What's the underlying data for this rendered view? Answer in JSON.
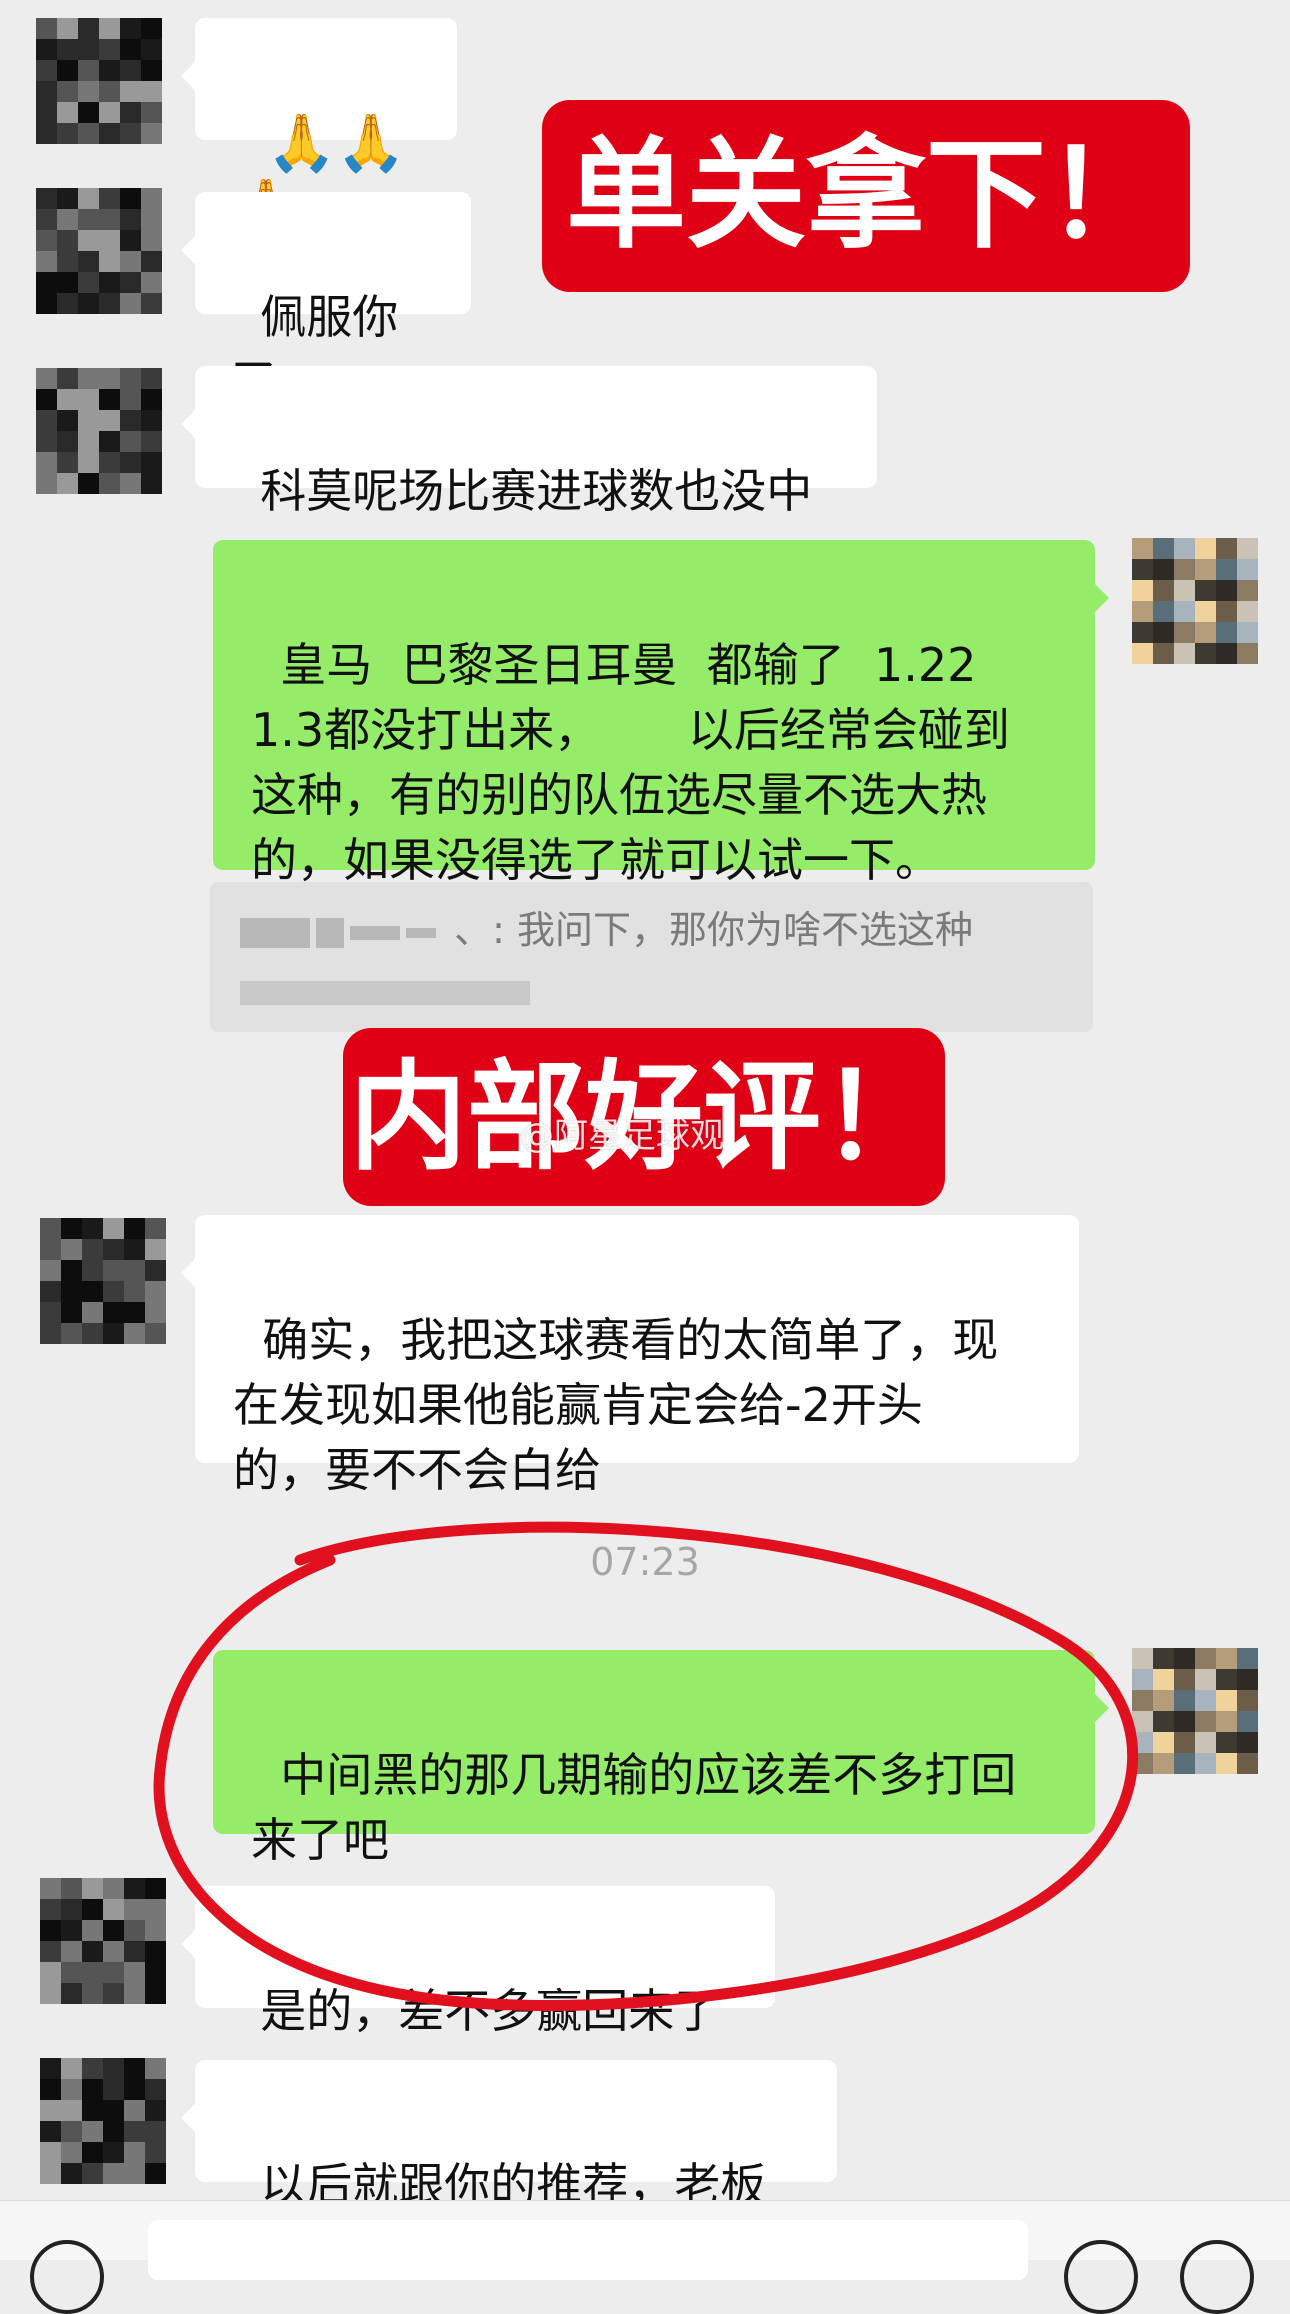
{
  "messages": [
    {
      "id": "m1",
      "side": "in",
      "text": "🙏🙏🙏"
    },
    {
      "id": "m2",
      "side": "in",
      "text": "佩服你了"
    },
    {
      "id": "m3",
      "side": "in",
      "text": "科莫呢场比赛进球数也没中"
    },
    {
      "id": "m4",
      "side": "out",
      "text": "皇马  巴黎圣日耳曼  都输了  1.22\n1.3都没打出来，      以后经常会碰到\n这种，有的别的队伍选尽量不选大热\n的，如果没得选了就可以试一下。"
    },
    {
      "id": "m5",
      "side": "in",
      "text": "确实，我把这球赛看的太简单了，现\n在发现如果他能赢肯定会给-2开头\n的，要不不会白给"
    },
    {
      "id": "m6",
      "side": "out",
      "text": "中间黑的那几期输的应该差不多打回\n来了吧"
    },
    {
      "id": "m7",
      "side": "in",
      "text": "是的，差不多赢回来了"
    },
    {
      "id": "m8",
      "side": "in",
      "text": "以后就跟你的推荐，老板"
    }
  ],
  "quote": {
    "suffix": "、: 我问下，那你为啥不选这种"
  },
  "banners": {
    "top": "单关拿下！",
    "middle": "内部好评！"
  },
  "watermark": "@阿星足球观",
  "timestamp": "07:23",
  "colors": {
    "incoming": "#ffffff",
    "outgoing": "#95ec69",
    "banner": "#e00016",
    "circle": "#e0101e",
    "background": "#ededed"
  }
}
